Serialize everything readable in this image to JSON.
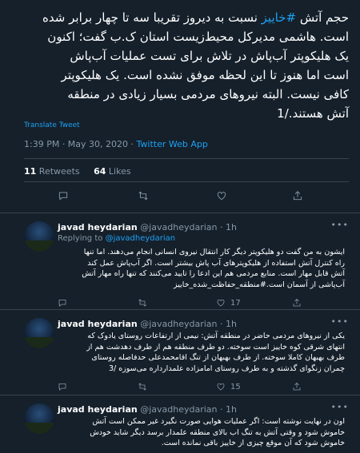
{
  "main_tweet": {
    "text_lines": [
      "حجم آتش #خاییز نسبت به دیروز تقریبا سه تا چهار برابر شده",
      "است. هاشمی مدیرکل محیط‌زیست استان ک.ب گفت؛ اکنون",
      "یک هلیکوپتر آب‌پاش در تلاش برای تست عملیات آب‌پاش",
      "است اما هنوز تا این لحظه موفق نشده است. یک هلیکوپتر",
      "کافی نیست. البته نیروهای مردمی بسیار زیادی در منطقه",
      "آتش هستند./1"
    ],
    "line1_before": "حجم آتش ",
    "hashtag": "#خاییز",
    "line1_after": " نسبت به دیروز تقریبا سه تا چهار برابر شده",
    "translate_label": "Translate Tweet",
    "time": "1:39 PM · May 30, 2020 · ",
    "source": "Twitter Web App",
    "retweets_count": "11",
    "retweets_label": " Retweets",
    "likes_count": "64",
    "likes_label": " Likes"
  },
  "replies": [
    {
      "name": "javad heydarian",
      "handle": "@javadheydarian",
      "time": " · 1h",
      "replying_label": "Replying to ",
      "replying_to": "@javadheydarian",
      "text_lines": [
        "ایشون به من گفت دو هلیکوپتر دیگر کار انتقال نیروی انسانی انجام می‌دهند. اما تنها",
        "راه کنترل آتش استفاده از هلیکوپترهای آب پاش بیشتر است. اگر آب‌پاش عمل کند",
        "آتش قابل مهار است. منابع مردمی هم این ادعا را تایید می‌کنند که تنها راه مهار آتش",
        "آب‌پاشی از آسمان است.#منطقه_حفاظت_شده_خاییز"
      ],
      "likes": "17"
    },
    {
      "name": "javad heydarian",
      "handle": "@javadheydarian",
      "time": " · 1h",
      "text_lines": [
        "یکی از نیروهای مردمی حاضر در منطقه آتش: نیمی از ارتفاعات روستای یادوک که",
        "انتهای شرقی کوه خاییز است سوخته. دو طرف منطقه هم از طرف دهدشت هم از",
        "طرف بهبهان کاملا سوخته. از طرف بهبهان از تنگ اقامحمدعلی حدفاصله روستای",
        "چمران زنگوای گذشته و به طرف روستای امامزاده علمدارداره می‌سوزه /3"
      ],
      "likes": "15"
    },
    {
      "name": "javad heydarian",
      "handle": "@javadheydarian",
      "time": " · 1h",
      "text_lines": [
        "اون در نهایت نوشته است: اگر عملیات هوایی صورت نگیرد غیر ممکن است آتش",
        "خاموش شود و وقتی آتش به تنگ اب بالای منطقه علمدار برسد دیگر شاید خودش",
        "خاموش شود که آن موقع چیزی از خاییز باقی نمانده است."
      ]
    }
  ]
}
